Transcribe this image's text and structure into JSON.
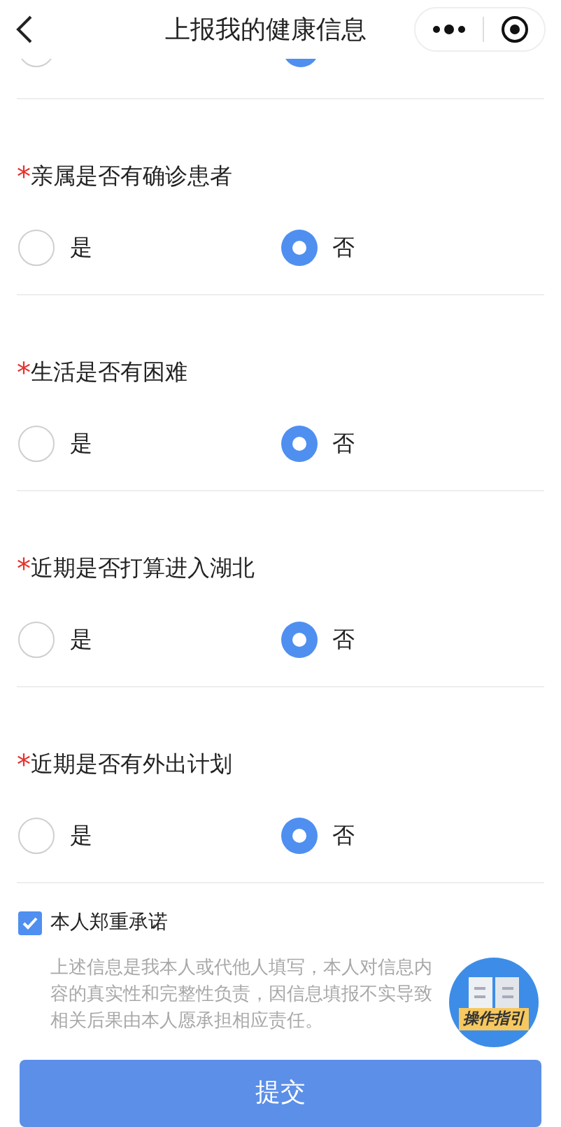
{
  "header": {
    "title": "上报我的健康信息"
  },
  "partial_row": {
    "options": [
      {
        "selected": false
      },
      {
        "selected": true
      }
    ]
  },
  "questions": [
    {
      "label": "亲属是否有确诊患者",
      "required_mark": "*",
      "options": [
        {
          "label": "是",
          "selected": false
        },
        {
          "label": "否",
          "selected": true
        }
      ]
    },
    {
      "label": "生活是否有困难",
      "required_mark": "*",
      "options": [
        {
          "label": "是",
          "selected": false
        },
        {
          "label": "否",
          "selected": true
        }
      ]
    },
    {
      "label": "近期是否打算进入湖北",
      "required_mark": "*",
      "options": [
        {
          "label": "是",
          "selected": false
        },
        {
          "label": "否",
          "selected": true
        }
      ]
    },
    {
      "label": "近期是否有外出计划",
      "required_mark": "*",
      "options": [
        {
          "label": "是",
          "selected": false
        },
        {
          "label": "否",
          "selected": true
        }
      ]
    }
  ],
  "pledge": {
    "label": "本人郑重承诺",
    "checked": true,
    "text": "上述信息是我本人或代他人填写，本人对信息内容的真实性和完整性负责，因信息填报不实导致相关后果由本人愿承担相应责任。"
  },
  "guide_button": {
    "label": "操作指引"
  },
  "submit_button": {
    "label": "提交"
  }
}
